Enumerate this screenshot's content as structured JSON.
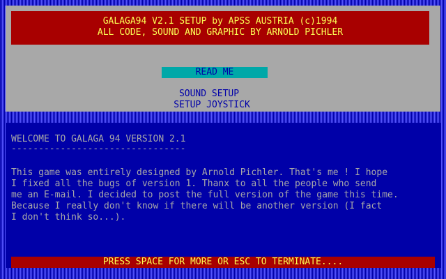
{
  "header": {
    "line1": "GALAGA94 V2.1 SETUP by APSS AUSTRIA (c)1994",
    "line2": "ALL CODE, SOUND AND GRAPHIC BY ARNOLD PICHLER"
  },
  "menu": {
    "items": [
      {
        "label": "READ ME",
        "selected": true
      },
      {
        "label": "SOUND SETUP",
        "selected": false
      },
      {
        "label": "SETUP JOYSTICK",
        "selected": false
      }
    ]
  },
  "content": {
    "heading": "WELCOME TO GALAGA 94 VERSION 2.1",
    "underline": "--------------------------------",
    "paragraph": [
      "This game was entirely designed by Arnold Pichler. That's me ! I hope",
      "I fixed all the bugs of version 1. Thanx to all the people who send",
      "me an E-mail. I decided to post the full version of the game this time.",
      "Because I really don't know if there will be another version (I fact",
      "I don't think so...)."
    ]
  },
  "status": {
    "text": "PRESS SPACE FOR MORE OR ESC TO TERMINATE...."
  },
  "colors": {
    "background_blue": "#0000a8",
    "panel_gray": "#a8a8a8",
    "band_red": "#a80000",
    "text_yellow": "#fcfc54",
    "selection_cyan": "#00a8a8"
  }
}
